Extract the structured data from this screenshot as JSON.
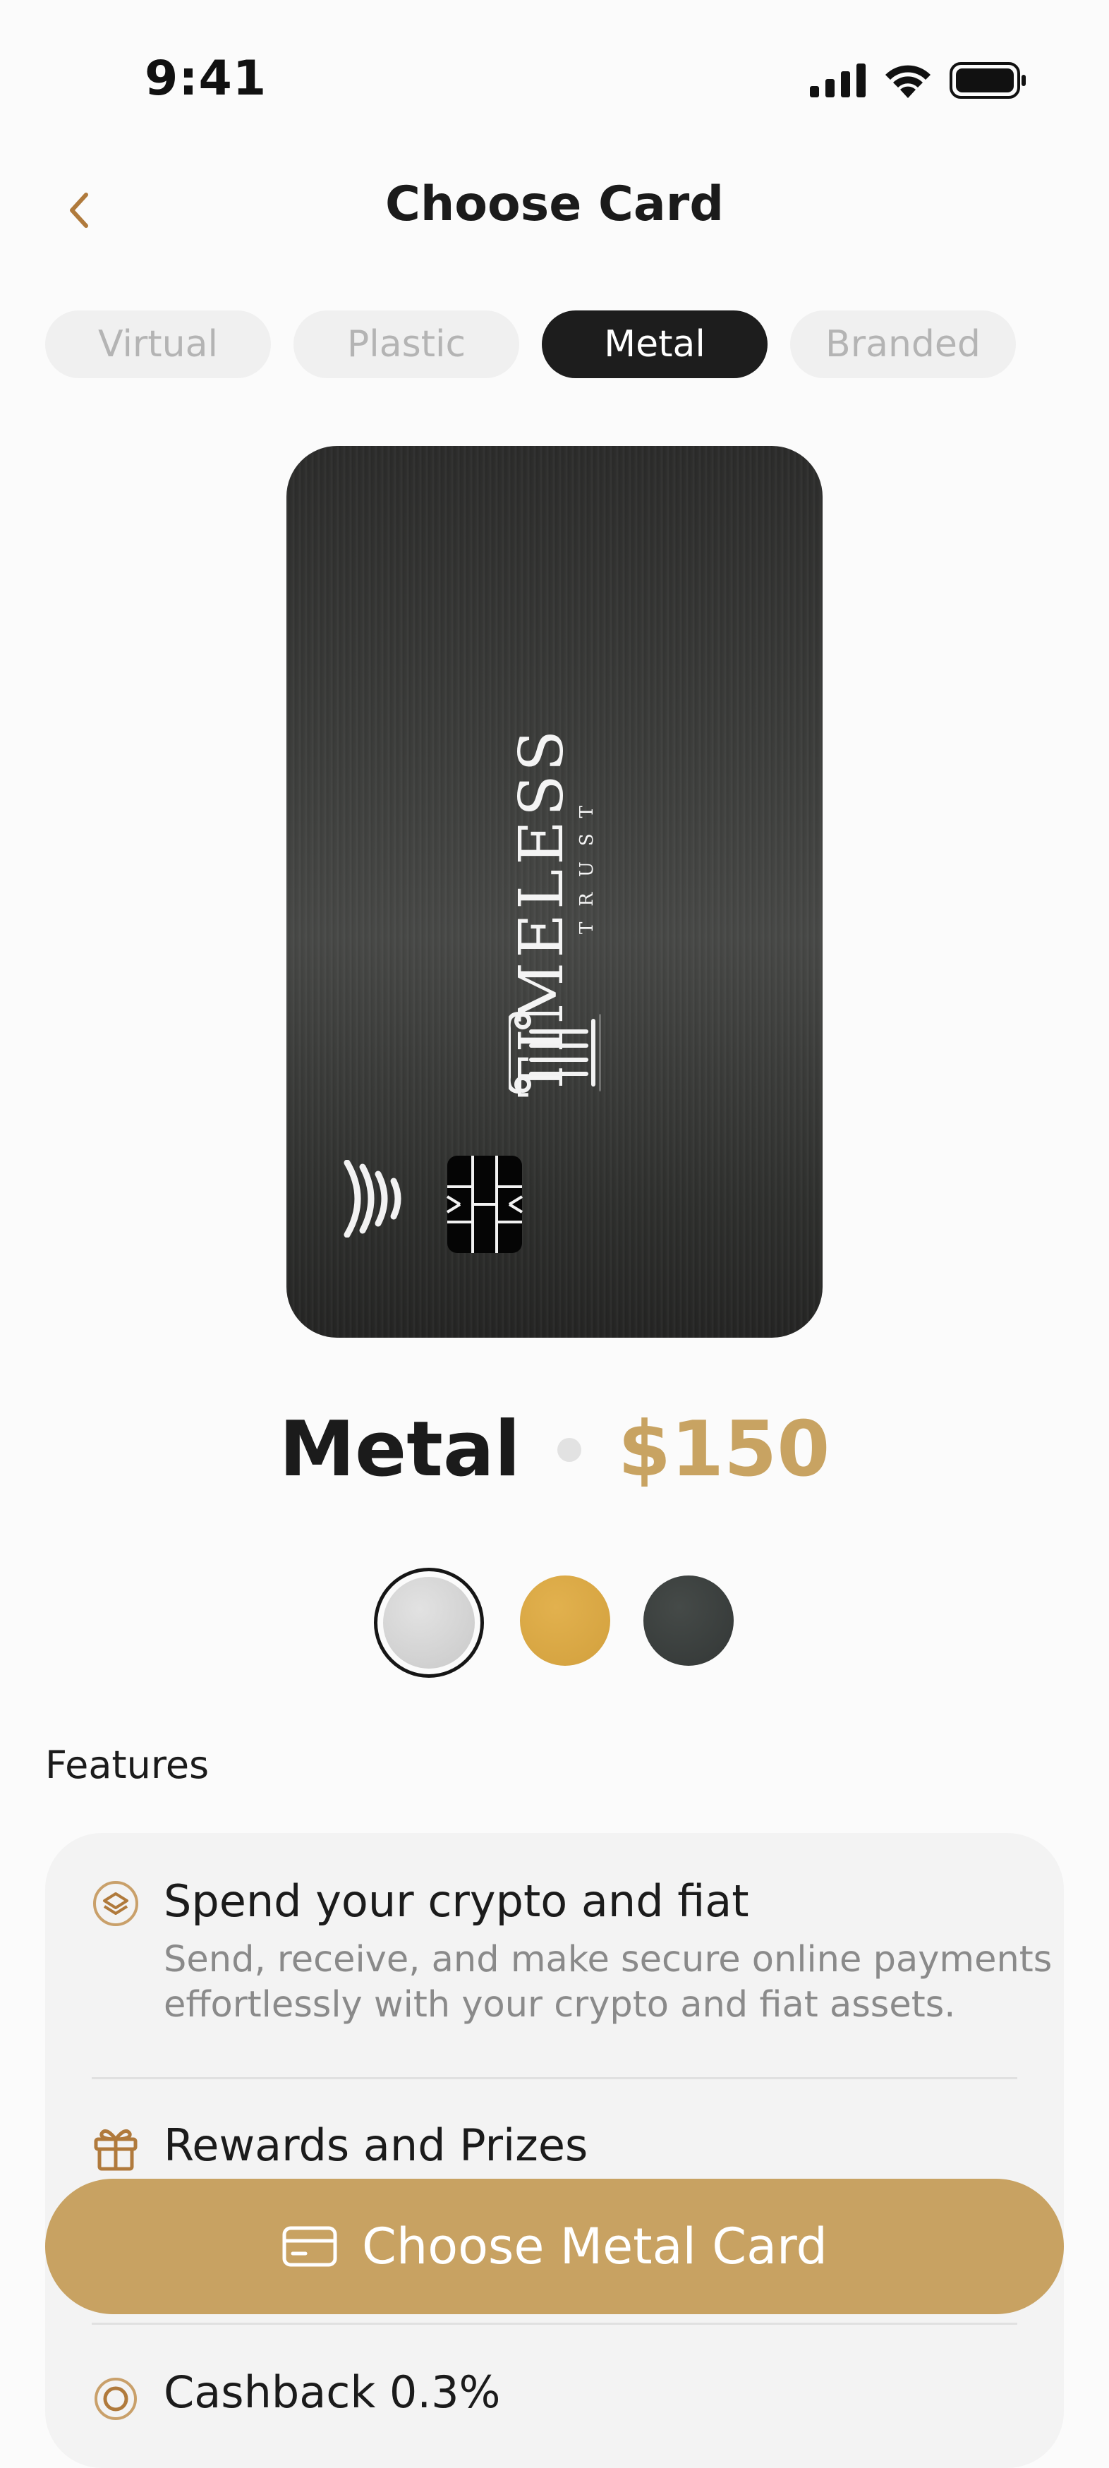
{
  "status_bar": {
    "time": "9:41"
  },
  "header": {
    "title": "Choose Card"
  },
  "tabs": [
    {
      "label": "Virtual",
      "active": false
    },
    {
      "label": "Plastic",
      "active": false
    },
    {
      "label": "Metal",
      "active": true
    },
    {
      "label": "Branded",
      "active": false
    }
  ],
  "card_preview": {
    "brand_name": "TIMELESS",
    "brand_subtitle": "TRUST"
  },
  "selected_card": {
    "name": "Metal",
    "price": "$150"
  },
  "color_options": [
    {
      "name": "silver",
      "color": "#d4d4d4",
      "selected": true
    },
    {
      "name": "gold",
      "color": "#d9a845",
      "selected": false
    },
    {
      "name": "dark",
      "color": "#3a3e3d",
      "selected": false
    }
  ],
  "features": {
    "label": "Features",
    "items": [
      {
        "icon": "crypto-stack-icon",
        "title": "Spend your crypto and fiat",
        "description_line1": "Send, receive, and make secure online payments",
        "description_line2": "effortlessly with your crypto and fiat assets."
      },
      {
        "icon": "gift-icon",
        "title": "Rewards and Prizes"
      },
      {
        "icon": "cashback-icon",
        "title": "Cashback 0.3%"
      }
    ]
  },
  "cta": {
    "label": "Choose Metal Card",
    "icon": "card-icon"
  },
  "colors": {
    "accent": "#c8a262",
    "dark": "#1d1d1d"
  }
}
